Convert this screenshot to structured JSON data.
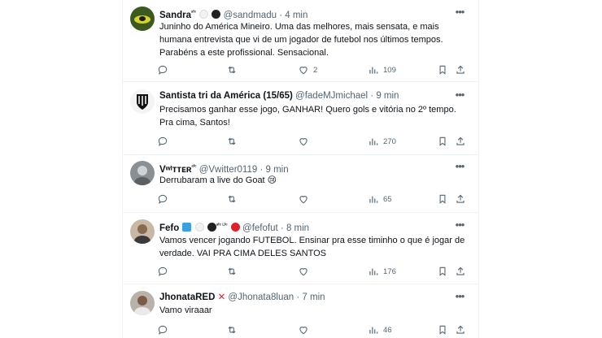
{
  "posts": [
    {
      "display_name": "Sandra",
      "name_suffix": "ᵃᶠᶜ",
      "handle": "@sandmadu",
      "separator": "·",
      "time": "4 min",
      "text": "Juninho do América Mineiro. Uma das melhores, mais sensata, e mais humana entrevista que vi de um jogador de futebol nos últimos tempos. Parabéns a este profissional. Sensacional.",
      "replies": "",
      "reposts": "",
      "likes": "2",
      "views": "109"
    },
    {
      "display_name": "Santista tri da América (15/65)",
      "name_suffix": "",
      "handle": "@fadeMJmichael",
      "separator": "·",
      "time": "9 min",
      "text": "Precisamos ganhar esse jogo, GANHAR! Quero gols e vitória no 2º tempo. Pra cima, Santos!",
      "replies": "",
      "reposts": "",
      "likes": "",
      "views": "270"
    },
    {
      "display_name": "Vʷᴵᴛᴛᴇʀ",
      "name_suffix": "ᵃᶠᶜ",
      "handle": "@Vwitter0119",
      "separator": "·",
      "time": "9 min",
      "text": "Derrubaram a live do Goat 😢",
      "replies": "",
      "reposts": "",
      "likes": "",
      "views": "65"
    },
    {
      "display_name": "Fefo",
      "name_suffix": "ᵃᶠᶜ ᴸᶠᶜ",
      "handle": "@fefofut",
      "separator": "·",
      "time": "8 min",
      "text": "Vamos vencer jogando FUTEBOL. Ensinar pra esse timinho o que é jogar de verdade. VAI PRA CIMA DELES SANTOS",
      "replies": "",
      "reposts": "",
      "likes": "",
      "views": "176"
    },
    {
      "display_name": "JhonataRED",
      "name_suffix": "",
      "handle": "@Jhonata8luan",
      "separator": "·",
      "time": "7 min",
      "text": "Vamo viraaar",
      "replies": "",
      "reposts": "",
      "likes": "",
      "views": "46"
    }
  ],
  "more_glyph": "•••",
  "colors": {
    "text": "#0f1419",
    "secondary": "#536471",
    "border": "#eff3f4"
  }
}
